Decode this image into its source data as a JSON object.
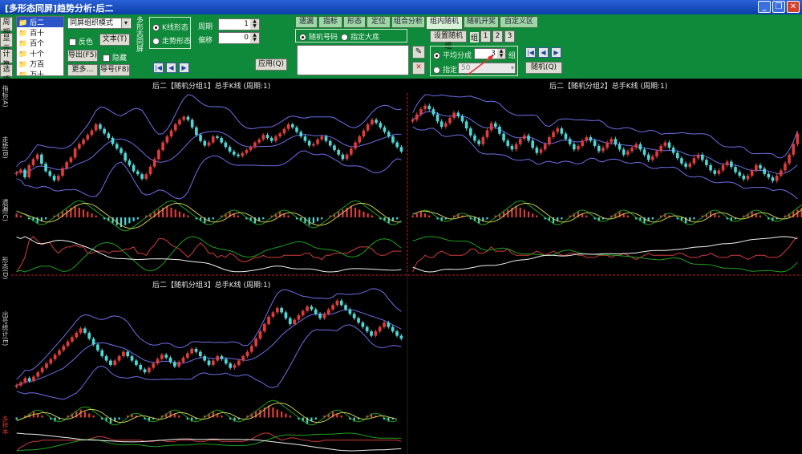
{
  "window": {
    "title": "[多形态同屏]趋势分析:后二",
    "buttons": [
      "_",
      "❐",
      "✕"
    ]
  },
  "left_tools": [
    "周期",
    "显示",
    "计算",
    "选项"
  ],
  "list": {
    "items": [
      "后二",
      "百十",
      "百个",
      "十个",
      "万百",
      "万十"
    ]
  },
  "mode_select": {
    "value": "同屏组织模式"
  },
  "options": {
    "checkbox_label": "反色",
    "text_button": "文本(T)",
    "export_button": "导出(F5)",
    "hide_label": "隐藏",
    "more_button": "更多…",
    "print_button": "导号(F8)"
  },
  "green_panel": {
    "side_text": "多形态同屏",
    "radio_kline": "K线形态",
    "radio_trend": "走势形态",
    "period_label": "周期",
    "period_value": "1",
    "offset_label": "偏移",
    "offset_value": "0",
    "apply_button": "应用(Q)"
  },
  "tabs": [
    "遗漏",
    "指标",
    "形态",
    "定位",
    "组合分析",
    "组内随机",
    "随机开奖",
    "自定义区"
  ],
  "active_tab": 5,
  "random_panel": {
    "radio_random": "随机号码",
    "radio_fixed": "指定大底",
    "group_button": "设置随机组",
    "group_label": "组",
    "group_nums": [
      "1",
      "2",
      "3"
    ],
    "avg_label": "平均分成",
    "avg_value": "3",
    "avg_unit": "组",
    "fixed_label": "指定",
    "fixed_value": "50",
    "random_button": "随机(Q)"
  },
  "left_bar_labels": [
    "指标(A)",
    "走势(B)",
    "遗漏(C)",
    "形态(D)",
    "出号统计(E)",
    "多样本"
  ],
  "colors": {
    "title_bg": "#0a3ea8",
    "panel_green": "#0e8a3a",
    "up_candle": "#e03c3c",
    "down_candle": "#4fd6d6",
    "band_line": "#6e6ee8",
    "green_line": "#1ea01e",
    "red_line": "#d23c3c",
    "white_line": "#f0f0f0"
  },
  "chart_data": [
    {
      "type": "candlestick",
      "title": "后二【随机分组1】总手K线 (周期:1)",
      "close": [
        51,
        53,
        48,
        56,
        60,
        63,
        57,
        52,
        49,
        46,
        49,
        54,
        58,
        61,
        67,
        70,
        73,
        76,
        79,
        83,
        80,
        77,
        74,
        70,
        67,
        64,
        59,
        56,
        52,
        50,
        47,
        50,
        55,
        60,
        66,
        71,
        75,
        79,
        83,
        86,
        88,
        86,
        81,
        76,
        72,
        69,
        71,
        75,
        74,
        71,
        68,
        65,
        63,
        62,
        64,
        66,
        68,
        71,
        73,
        76,
        74,
        72,
        75,
        77,
        80,
        83,
        81,
        78,
        75,
        72,
        69,
        70,
        73,
        75,
        72,
        69,
        66,
        63,
        60,
        63,
        67,
        71,
        75,
        79,
        83,
        86,
        84,
        81,
        78,
        75,
        71,
        68,
        65
      ],
      "macd_diff": [
        2,
        1,
        0,
        -1,
        -2,
        -3,
        -2,
        -1,
        0,
        1,
        2,
        3,
        4,
        5,
        6,
        5,
        4,
        3,
        2,
        1,
        0,
        -1,
        -2,
        -3,
        -4,
        -5,
        -4,
        -3,
        -2,
        -1,
        0,
        1,
        2,
        3,
        4,
        5,
        6,
        5,
        4,
        3,
        2,
        1,
        0,
        -1,
        -2,
        -3,
        -2,
        -1,
        0,
        1,
        2,
        3,
        2,
        1,
        0,
        -1,
        -2,
        -3,
        -2,
        -1,
        0,
        1,
        2,
        3,
        2,
        1,
        0,
        -1,
        -2,
        -3,
        -4,
        -3,
        -2,
        -1,
        0,
        1,
        2,
        3,
        4,
        5,
        6,
        5,
        4,
        3,
        2,
        1,
        0,
        -1,
        -2,
        -3,
        -2,
        -1,
        0
      ]
    },
    {
      "type": "candlestick",
      "title": "后二【随机分组2】总手K线 (周期:1)",
      "close": [
        72,
        75,
        78,
        80,
        78,
        75,
        71,
        68,
        70,
        73,
        76,
        74,
        71,
        67,
        63,
        60,
        58,
        62,
        66,
        70,
        68,
        64,
        60,
        57,
        55,
        58,
        61,
        63,
        60,
        56,
        53,
        55,
        58,
        62,
        65,
        67,
        64,
        61,
        58,
        55,
        57,
        60,
        62,
        60,
        57,
        54,
        56,
        59,
        61,
        58,
        55,
        52,
        54,
        56,
        58,
        55,
        52,
        49,
        51,
        54,
        57,
        59,
        56,
        53,
        50,
        47,
        45,
        47,
        50,
        52,
        49,
        46,
        43,
        41,
        43,
        46,
        48,
        45,
        42,
        40,
        38,
        40,
        43,
        46,
        44,
        41,
        39,
        37,
        40,
        43,
        47,
        52,
        58,
        64
      ],
      "macd_diff": [
        1,
        2,
        3,
        2,
        1,
        0,
        -1,
        -2,
        -1,
        0,
        1,
        2,
        1,
        0,
        -1,
        -2,
        -3,
        -2,
        -1,
        0,
        1,
        2,
        3,
        4,
        5,
        6,
        5,
        4,
        3,
        2,
        1,
        0,
        -1,
        -2,
        -3,
        -2,
        -1,
        0,
        1,
        2,
        3,
        2,
        1,
        0,
        -1,
        -2,
        -1,
        0,
        1,
        2,
        3,
        2,
        1,
        0,
        -1,
        -2,
        -3,
        -2,
        -1,
        0,
        1,
        2,
        1,
        0,
        -1,
        -2,
        -3,
        -2,
        -1,
        0,
        1,
        2,
        3,
        2,
        1,
        0,
        -1,
        -2,
        -1,
        0,
        1,
        2,
        3,
        2,
        1,
        0,
        -1,
        -2,
        -1,
        0,
        1,
        2,
        3,
        4,
        5,
        6
      ]
    },
    {
      "type": "candlestick",
      "title": "后二【随机分组3】总手K线 (周期:1)",
      "close": [
        38,
        40,
        43,
        41,
        44,
        47,
        50,
        53,
        56,
        59,
        62,
        65,
        68,
        71,
        74,
        77,
        74,
        70,
        66,
        62,
        58,
        55,
        52,
        55,
        58,
        61,
        58,
        55,
        52,
        49,
        47,
        50,
        53,
        56,
        59,
        57,
        54,
        51,
        54,
        57,
        60,
        63,
        61,
        58,
        55,
        52,
        55,
        58,
        56,
        53,
        50,
        52,
        55,
        58,
        61,
        65,
        70,
        75,
        80,
        85,
        88,
        91,
        88,
        84,
        80,
        83,
        86,
        89,
        92,
        90,
        87,
        84,
        87,
        90,
        93,
        96,
        93,
        90,
        87,
        84,
        81,
        78,
        75,
        72,
        75,
        78,
        81,
        78,
        75,
        72,
        70
      ],
      "macd_diff": [
        -1,
        0,
        1,
        2,
        3,
        2,
        1,
        0,
        -1,
        -2,
        -1,
        0,
        1,
        2,
        3,
        4,
        3,
        2,
        1,
        0,
        -1,
        -2,
        -3,
        -2,
        -1,
        0,
        1,
        2,
        1,
        0,
        -1,
        -2,
        -1,
        0,
        1,
        2,
        3,
        2,
        1,
        0,
        -1,
        -2,
        -1,
        0,
        1,
        2,
        3,
        2,
        1,
        0,
        -1,
        -2,
        -1,
        0,
        1,
        2,
        3,
        4,
        5,
        6,
        5,
        4,
        3,
        2,
        1,
        0,
        -1,
        -2,
        -3,
        -2,
        -1,
        0,
        1,
        2,
        3,
        2,
        1,
        0,
        -1,
        -2,
        -1,
        0,
        1,
        2,
        1,
        0,
        -1,
        -2,
        -1,
        0
      ]
    }
  ]
}
